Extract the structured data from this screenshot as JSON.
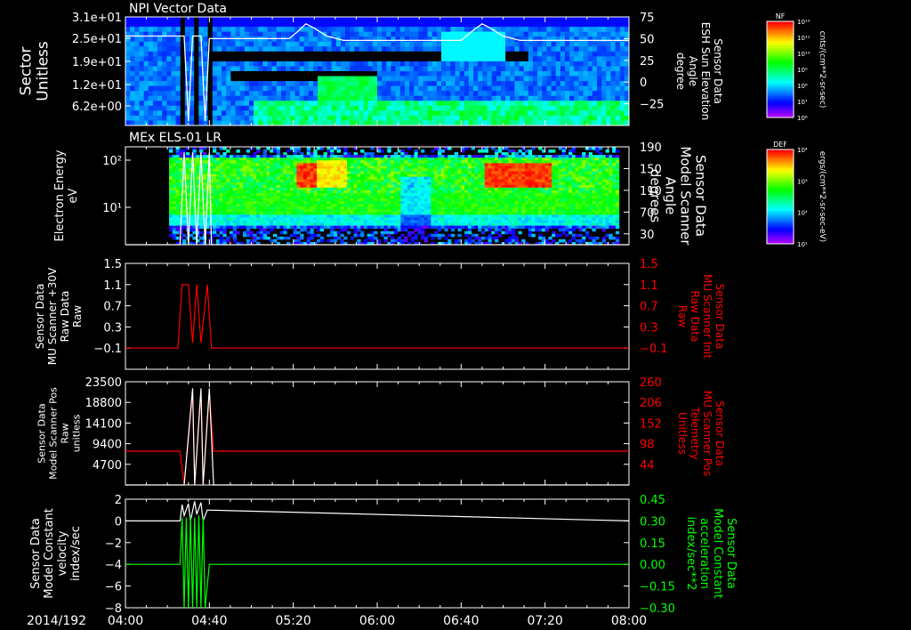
{
  "colors": {
    "background": "#000000",
    "axis": "#ffffff",
    "red": "#ff0000",
    "green": "#00ff00",
    "white": "#ffffff"
  },
  "x_axis": {
    "date_label": "2014/192",
    "ticks": [
      "04:00",
      "04:40",
      "05:20",
      "06:00",
      "06:40",
      "07:20",
      "08:00"
    ],
    "range_min": [
      240,
      480
    ]
  },
  "colorbars": [
    {
      "title": "NF",
      "unit": "cnts/(cm**2-sr-sec)",
      "tick_labels": [
        "10¹²",
        "10¹¹",
        "10¹⁰",
        "10⁹",
        "10⁸",
        "10⁷",
        "10⁶"
      ]
    },
    {
      "title": "DEF",
      "unit": "ergs/(cm**2-sr-sec-eV)",
      "tick_labels": [
        "10⁴",
        "10³",
        "10²",
        "10¹"
      ]
    }
  ],
  "chart_data": [
    {
      "type": "heatmap",
      "title": "NPI Vector Data",
      "ylabel_lines": [
        "Sector",
        "Unitless"
      ],
      "yticks_left": [
        "3.1e+01",
        "2.5e+01",
        "1.9e+01",
        "1.2e+01",
        "6.2e+00"
      ],
      "ylabel_right_lines": [
        "Sensor Data",
        "ESH Sun Elevation",
        "Angle",
        "degree"
      ],
      "yticks_right": [
        "75",
        "50",
        "25",
        "0",
        "−25"
      ],
      "yrange_right": [
        -50,
        75
      ],
      "overlay_line": {
        "name": "ESH Sun Elevation",
        "color": "#ffffff",
        "x": [
          240,
          268,
          270,
          272,
          276,
          278,
          280,
          318,
          322,
          326,
          330,
          336,
          344,
          400,
          406,
          410,
          414,
          420,
          428,
          480
        ],
        "y": [
          53,
          53,
          -45,
          53,
          53,
          -45,
          50,
          50,
          58,
          67,
          62,
          53,
          48,
          48,
          60,
          67,
          62,
          53,
          48,
          48
        ]
      }
    },
    {
      "type": "heatmap",
      "title": "MEx ELS-01 LR",
      "ylabel_lines": [
        "Electron Energy",
        "eV"
      ],
      "yticks_left": [
        "10²",
        "10¹"
      ],
      "ylabel_right_lines": [
        "Sensor Data",
        "Model Scanner",
        "Angle",
        "degrees"
      ],
      "yticks_right": [
        "190",
        "150",
        "110",
        "70",
        "30"
      ],
      "yrange_right": [
        10,
        190
      ]
    },
    {
      "type": "line",
      "ylabel_lines": [
        "Sensor Data",
        "MU Scanner +30V",
        "Raw Data",
        "Raw"
      ],
      "yticks_left": [
        "1.5",
        "1.1",
        "0.7",
        "0.3",
        "−0.1"
      ],
      "yrange": [
        -0.5,
        1.5
      ],
      "ylabel_right_lines": [
        "Sensor Data",
        "MU Scanner Init",
        "Raw Data",
        "Raw"
      ],
      "yticks_right": [
        "1.5",
        "1.1",
        "0.7",
        "0.3",
        "−0.1"
      ],
      "series": [
        {
          "name": "MU Scanner Init",
          "color": "#ff0000",
          "x": [
            240,
            265,
            267,
            270,
            272,
            274,
            276,
            279,
            281,
            480
          ],
          "y": [
            -0.1,
            -0.1,
            1.1,
            1.1,
            0.0,
            1.1,
            0.0,
            1.1,
            -0.1,
            -0.1
          ]
        }
      ]
    },
    {
      "type": "line",
      "ylabel_lines": [
        "Sensor Data",
        "Model Scanner Pos",
        "Raw",
        "unitless"
      ],
      "yticks_left": [
        "23500",
        "18800",
        "14100",
        "9400",
        "4700"
      ],
      "yrange": [
        0,
        23500
      ],
      "ylabel_right_lines": [
        "Sensor Data",
        "MU Scanner Pos",
        "Telemetry",
        "Unitless"
      ],
      "yticks_right": [
        "260",
        "206",
        "152",
        "98",
        "44"
      ],
      "series": [
        {
          "name": "MU Scanner Pos",
          "color": "#ff0000",
          "x": [
            240,
            266,
            268,
            272,
            273,
            276,
            277,
            280,
            282,
            480
          ],
          "y": [
            7700,
            7700,
            0,
            21000,
            0,
            21000,
            0,
            21000,
            7700,
            7700
          ]
        },
        {
          "name": "Model Scanner Pos",
          "color": "#ffffff",
          "x": [
            240,
            266,
            268,
            272,
            273,
            276,
            277,
            280,
            282,
            480
          ],
          "y": [
            0,
            0,
            0,
            22000,
            0,
            22000,
            0,
            22000,
            0,
            0
          ]
        }
      ]
    },
    {
      "type": "line",
      "ylabel_lines": [
        "Sensor Data",
        "Model Constant",
        "velocity",
        "index/sec"
      ],
      "yticks_left": [
        "2",
        "0",
        "−2",
        "−4",
        "−6",
        "−8"
      ],
      "yrange": [
        -8,
        2
      ],
      "ylabel_right_lines": [
        "Sensor Data",
        "Model Constant",
        "acceleration",
        "index/sec**2"
      ],
      "yticks_right": [
        "0.45",
        "0.30",
        "0.15",
        "0.00",
        "−0.15",
        "−0.30"
      ],
      "series": [
        {
          "name": "Model Constant velocity",
          "color": "#ffffff",
          "x": [
            240,
            266,
            267,
            268,
            270,
            271,
            273,
            274,
            276,
            277,
            279,
            480
          ],
          "y": [
            0,
            0,
            1.5,
            0.5,
            1.6,
            0,
            1.8,
            0.6,
            1.7,
            0,
            1.0,
            0
          ]
        },
        {
          "name": "Model Constant acceleration",
          "color": "#00ff00",
          "x": [
            240,
            266,
            267,
            268,
            269,
            270,
            271,
            272,
            273,
            274,
            275,
            276,
            277,
            278,
            280,
            480
          ],
          "y": [
            -4,
            -4,
            0.3,
            -8,
            0.3,
            -8,
            0.5,
            -8,
            0.3,
            -8,
            0.5,
            -8,
            0.3,
            -8,
            -4,
            -4
          ]
        }
      ]
    }
  ]
}
